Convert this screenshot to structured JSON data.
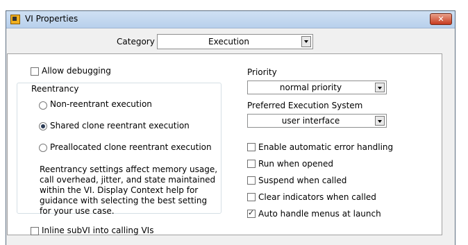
{
  "window": {
    "title": "VI Properties",
    "close_glyph": "✕"
  },
  "category": {
    "label": "Category",
    "value": "Execution"
  },
  "debugging": {
    "label": "Allow debugging",
    "checked": false
  },
  "reentrancy": {
    "group_label": "Reentrancy",
    "options": [
      {
        "label": "Non-reentrant execution",
        "selected": false
      },
      {
        "label": "Shared clone reentrant execution",
        "selected": true
      },
      {
        "label": "Preallocated clone reentrant execution",
        "selected": false
      }
    ],
    "note": "Reentrancy settings affect memory usage, call overhead, jitter, and state maintained within the VI. Display Context help for guidance with selecting the best setting for your use case."
  },
  "inline": {
    "label": "Inline subVI into calling VIs",
    "checked": false
  },
  "priority": {
    "label": "Priority",
    "value": "normal priority"
  },
  "exec_system": {
    "label": "Preferred Execution System",
    "value": "user interface"
  },
  "options": [
    {
      "label": "Enable automatic error handling",
      "checked": false
    },
    {
      "label": "Run when opened",
      "checked": false
    },
    {
      "label": "Suspend when called",
      "checked": false
    },
    {
      "label": "Clear indicators when called",
      "checked": false
    },
    {
      "label": "Auto handle menus at launch",
      "checked": true
    }
  ]
}
